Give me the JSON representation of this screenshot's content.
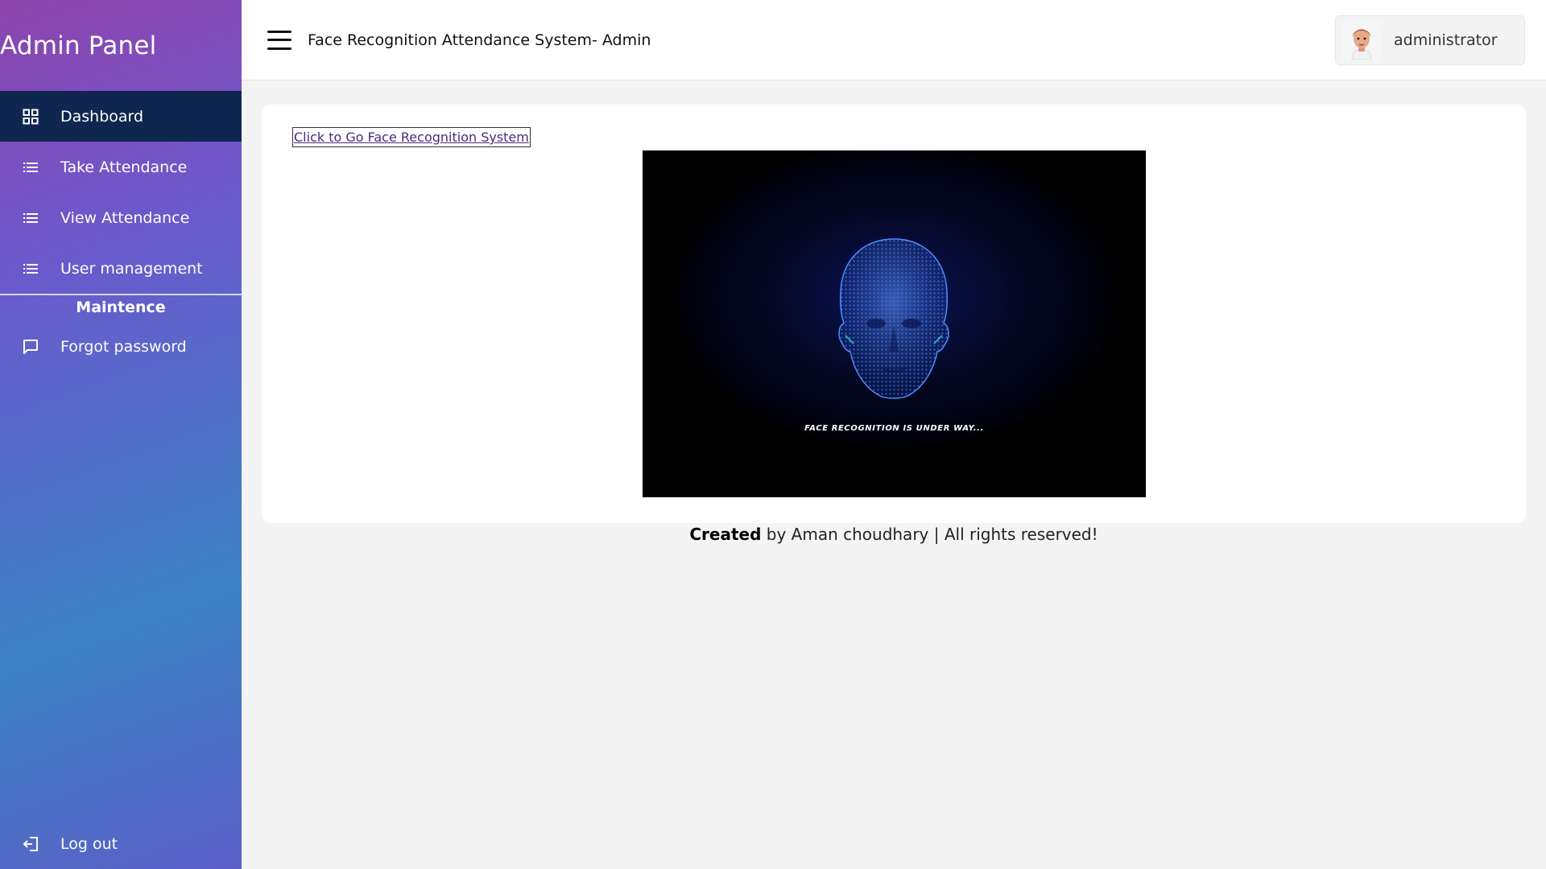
{
  "brand": {
    "title": "Admin Panel"
  },
  "sidebar": {
    "items": [
      {
        "label": "Dashboard",
        "icon": "grid-icon",
        "active": true
      },
      {
        "label": "Take Attendance",
        "icon": "list-icon"
      },
      {
        "label": "View Attendance",
        "icon": "list-icon"
      },
      {
        "label": "User management",
        "icon": "list-icon"
      }
    ],
    "section_title": "Maintence",
    "maintenance_items": [
      {
        "label": "Forgot password",
        "icon": "message-icon"
      }
    ],
    "logout_label": "Log out"
  },
  "header": {
    "title": "Face Recognition Attendance System- Admin",
    "user_name": "administrator"
  },
  "content": {
    "link_text": "Click to Go Face Recognition System",
    "video_caption": "FACE RECOGNITION IS UNDER WAY..."
  },
  "footer": {
    "bold": "Created",
    "rest": " by Aman choudhary | All rights reserved!"
  },
  "colors": {
    "active_nav": "#0f2650",
    "link": "#4b2a7b"
  }
}
